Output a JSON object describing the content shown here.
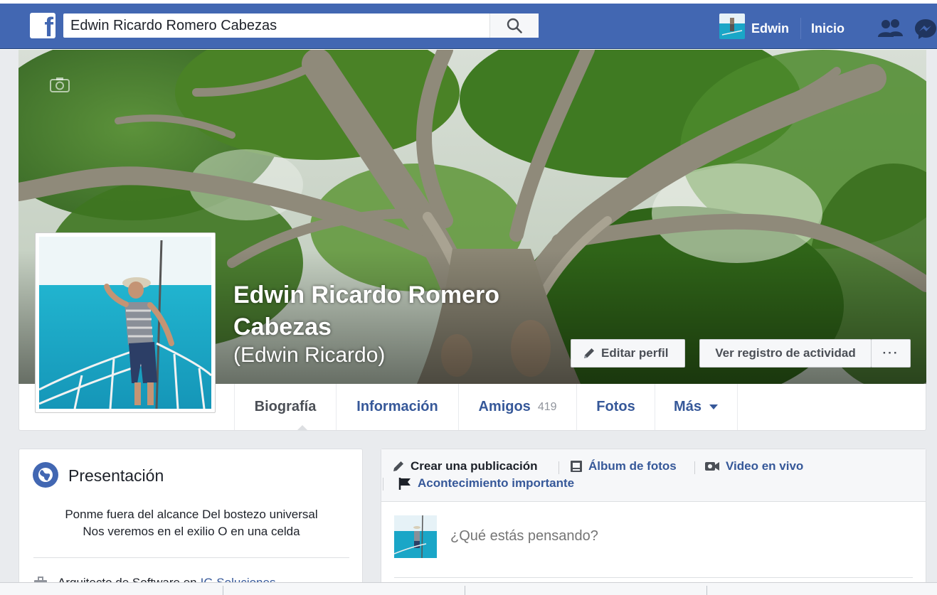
{
  "header": {
    "logo_icon": "facebook-logo-icon",
    "search_value": "Edwin Ricardo Romero Cabezas",
    "search_icon": "search-icon",
    "user_name": "Edwin",
    "home_label": "Inicio",
    "friends_icon": "friend-requests-icon",
    "messenger_icon": "messenger-icon",
    "brand_color": "#4267b2"
  },
  "profile": {
    "full_name": "Edwin Ricardo Romero Cabezas",
    "alternate_name": "(Edwin Ricardo)",
    "edit_profile_label": "Editar perfil",
    "activity_log_label": "Ver registro de actividad",
    "more_options_label": "···"
  },
  "tabs": [
    {
      "label": "Biografía",
      "active": true
    },
    {
      "label": "Información"
    },
    {
      "label": "Amigos",
      "count": "419"
    },
    {
      "label": "Fotos"
    },
    {
      "label": "Más",
      "icon": "caret-down-icon"
    }
  ],
  "intro": {
    "title": "Presentación",
    "bio_line1": "Ponme fuera del alcance Del bostezo universal",
    "bio_line2": "Nos veremos en el exilio O en una celda",
    "work_text": "Arquitecto de Software en",
    "work_company": "IG Soluciones"
  },
  "composer": {
    "create_post": "Crear una publicación",
    "photo_album": "Álbum de fotos",
    "live_video": "Video en vivo",
    "life_event": "Acontecimiento importante",
    "placeholder": "¿Qué estás pensando?"
  }
}
